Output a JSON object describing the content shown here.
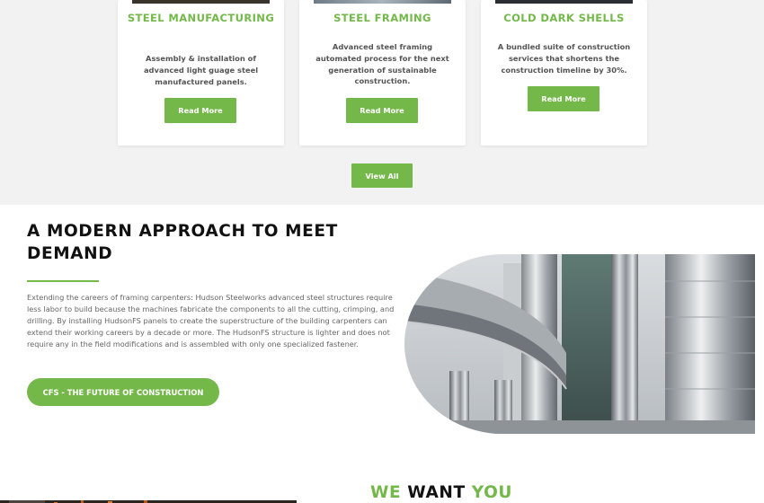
{
  "services": {
    "cards": [
      {
        "title": "STEEL MANUFACTURING",
        "text": "Assembly & installation of advanced light guage steel manufactured panels.",
        "button": "Read More"
      },
      {
        "title": "STEEL FRAMING",
        "text": "Advanced steel framing automated process for the next generation of sustainable construction.",
        "button": "Read More"
      },
      {
        "title": "COLD DARK SHELLS",
        "text": "A bundled suite of construction services that shortens the construction timeline by 30%.",
        "button": "Read More"
      }
    ],
    "view_all": "View All"
  },
  "approach": {
    "heading": "A MODERN APPROACH TO MEET DEMAND",
    "body": "Extending the careers of framing carpenters: Hudson Steelworks advanced steel structures require less labor to build because the machines fabricate the components to all the cutting, crimping, and drilling. By installing HudsonFS panels to create the superstructure of the building carpenters can extend their working careers by a decade or more. The HudsonFS structure is lighter and does not require any in the field modifications and is assembled with only one specialized fastener.",
    "button": "CFS - THE FUTURE OF CONSTRUCTION"
  },
  "want": {
    "part1": "WE",
    "part2": "WANT",
    "part3": "YOU"
  },
  "colors": {
    "accent": "#74b84a",
    "section_bg": "#f2f2f2"
  }
}
